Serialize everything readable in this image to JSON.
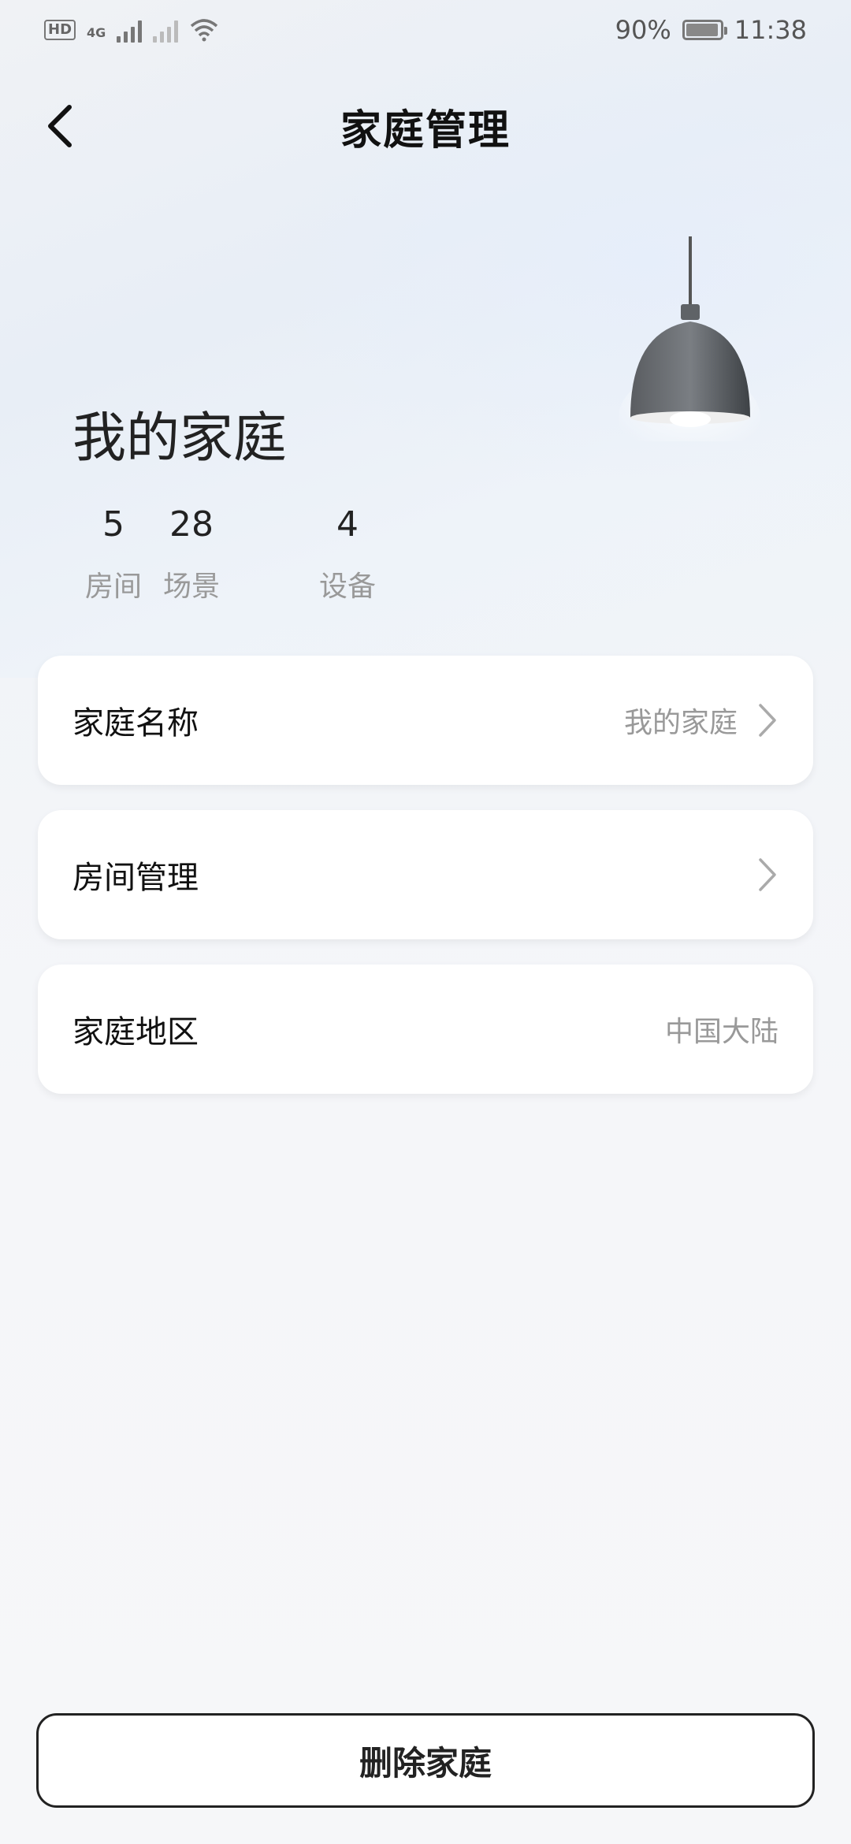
{
  "status_bar": {
    "hd_label": "HD",
    "network_label": "4G",
    "battery_percent": "90%",
    "battery_level": 0.9,
    "time": "11:38"
  },
  "header": {
    "title": "家庭管理",
    "back_icon": "chevron-left-icon"
  },
  "home": {
    "name": "我的家庭",
    "stats": [
      {
        "value": "5",
        "label": "房间"
      },
      {
        "value": "28",
        "label": "场景"
      },
      {
        "value": "4",
        "label": "设备"
      }
    ]
  },
  "settings": {
    "home_name": {
      "label": "家庭名称",
      "value": "我的家庭"
    },
    "room_management": {
      "label": "房间管理"
    },
    "home_region": {
      "label": "家庭地区",
      "value": "中国大陆"
    }
  },
  "actions": {
    "delete_label": "删除家庭"
  },
  "colors": {
    "title": "#111111",
    "secondary_text": "#999999",
    "card_bg": "#ffffff",
    "button_border": "#222222"
  }
}
